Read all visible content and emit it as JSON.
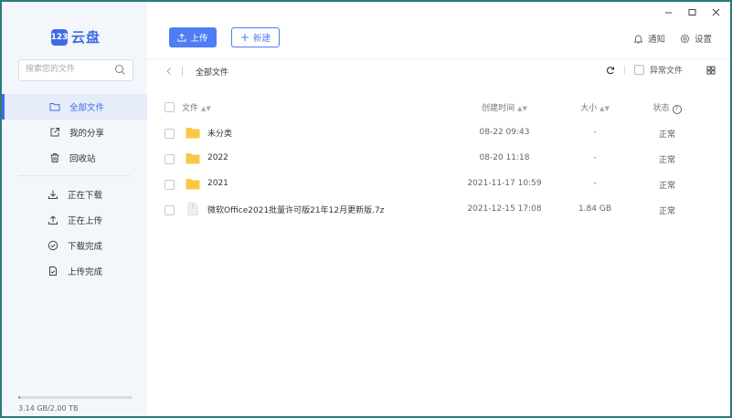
{
  "app": {
    "logo_badge": "123",
    "logo_text": "云盘"
  },
  "search": {
    "placeholder": "搜索您的文件"
  },
  "sidebar": {
    "items": [
      {
        "label": "全部文件",
        "icon": "folder-icon",
        "active": true
      },
      {
        "label": "我的分享",
        "icon": "share-icon"
      },
      {
        "label": "回收站",
        "icon": "trash-icon"
      }
    ],
    "transfer_items": [
      {
        "label": "正在下载",
        "icon": "download-icon"
      },
      {
        "label": "正在上传",
        "icon": "upload-icon"
      },
      {
        "label": "下载完成",
        "icon": "check-circle-icon"
      },
      {
        "label": "上传完成",
        "icon": "file-check-icon"
      }
    ],
    "storage": {
      "text": "3.14 GB/2.00 TB",
      "used_fraction": 0.0016
    }
  },
  "toolbar": {
    "upload_label": "上传",
    "new_label": "新建",
    "notify_label": "通知",
    "settings_label": "设置"
  },
  "breadcrumb": {
    "current": "全部文件"
  },
  "tools": {
    "abnormal_label": "异常文件"
  },
  "table": {
    "headers": {
      "name": "文件",
      "time": "创建时间",
      "size": "大小",
      "status": "状态"
    },
    "rows": [
      {
        "name": "未分类",
        "type": "folder",
        "time": "08-22 09:43",
        "size": "-",
        "status": "正常"
      },
      {
        "name": "2022",
        "type": "folder",
        "time": "08-20 11:18",
        "size": "-",
        "status": "正常"
      },
      {
        "name": "2021",
        "type": "folder",
        "time": "2021-11-17 10:59",
        "size": "-",
        "status": "正常"
      },
      {
        "name": "微软Office2021批量许可版21年12月更新版.7z",
        "type": "file",
        "time": "2021-12-15 17:08",
        "size": "1.84 GB",
        "status": "正常"
      }
    ]
  },
  "colors": {
    "accent": "#4f7df3",
    "brand": "#3f6ce6",
    "folder": "#f8c845",
    "sidebar_bg": "#f3f6fb"
  }
}
